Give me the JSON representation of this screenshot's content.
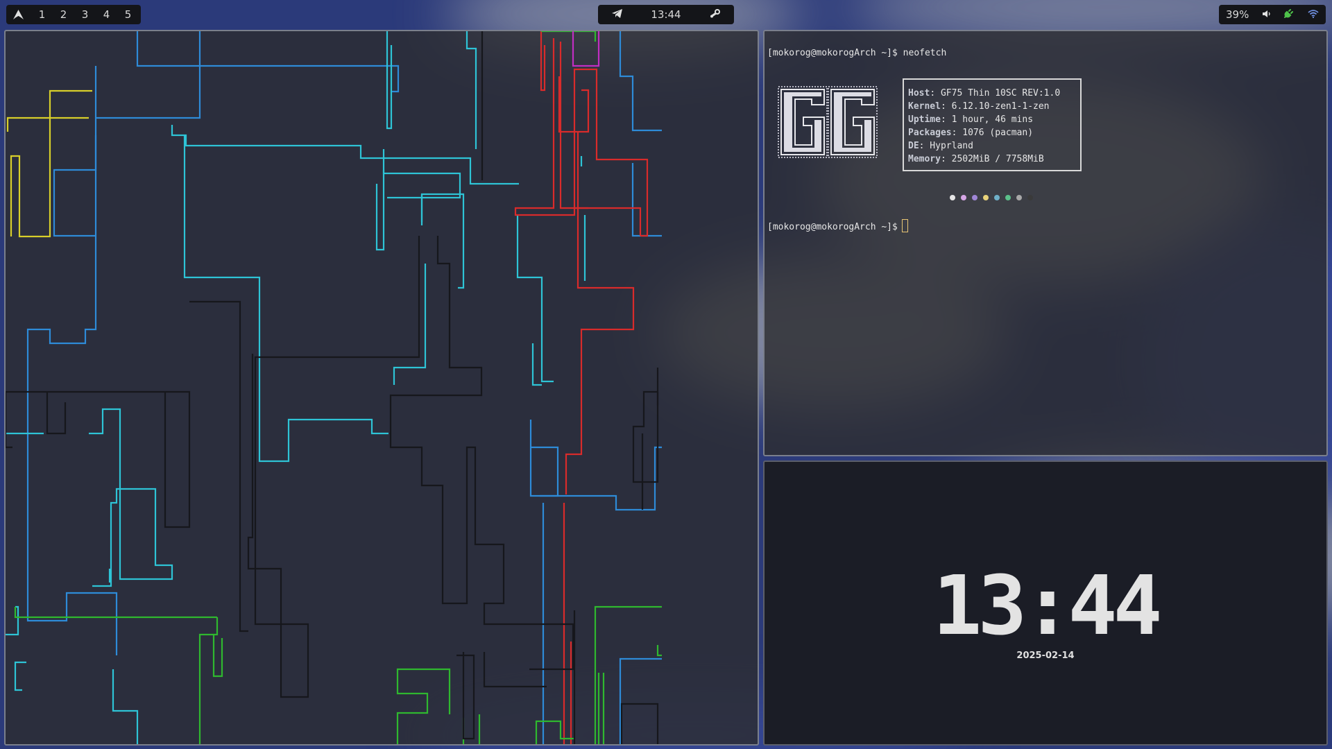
{
  "topbar": {
    "left": {
      "logo_icon": "arch-linux-logo",
      "workspaces": [
        "1",
        "2",
        "3",
        "4",
        "5"
      ]
    },
    "center": {
      "telegram_icon": "telegram-icon",
      "time": "13:44",
      "steam_icon": "steam-icon"
    },
    "right": {
      "battery": "39%",
      "volume_icon": "volume-icon",
      "power_icon": "power-plug-icon",
      "wifi_icon": "wifi-icon"
    }
  },
  "terminal": {
    "prompt_1": "[mokorog@mokorogArch ~]$ neofetch",
    "info": [
      {
        "key": "Host",
        "value": " GF75 Thin 10SC REV:1.0"
      },
      {
        "key": "Kernel",
        "value": " 6.12.10-zen1-1-zen"
      },
      {
        "key": "Uptime",
        "value": " 1 hour, 46 mins"
      },
      {
        "key": "Packages",
        "value": " 1076 (pacman)"
      },
      {
        "key": "DE",
        "value": " Hyprland"
      },
      {
        "key": "Memory",
        "value": " 2502MiB / 7758MiB"
      }
    ],
    "colors": [
      "#e6e6e6",
      "#d6a6e6",
      "#9f86d6",
      "#e8d27a",
      "#6fb0c8",
      "#5bc08a",
      "#a8a8a8",
      "#3a3a3a"
    ],
    "prompt_2": "[mokorog@mokorogArch ~]$"
  },
  "clock_widget": {
    "time": "13:44",
    "date": "2025-02-14"
  },
  "colors": {
    "pipe_colors": [
      "#2e8bd8",
      "#2ec4d6",
      "#d92b2b",
      "#2fb82f",
      "#d8cf2a",
      "#c12ec2",
      "#16171c"
    ],
    "bar_bg": "#141519",
    "accent_green": "#4fc34a",
    "wifi_blue": "#6f8fe0"
  }
}
